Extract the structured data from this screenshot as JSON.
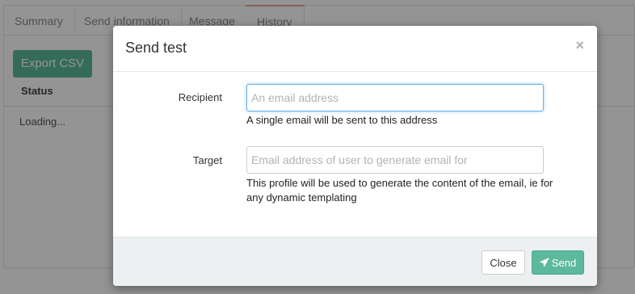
{
  "background": {
    "tabs": [
      "Summary",
      "Send information",
      "Message",
      "History"
    ],
    "active_tab": "History",
    "export_label": "Export CSV",
    "status_header": "Status",
    "loading_text": "Loading..."
  },
  "modal": {
    "title": "Send test",
    "close_symbol": "×",
    "recipient": {
      "label": "Recipient",
      "placeholder": "An email address",
      "value": "",
      "help": "A single email will be sent to this address"
    },
    "target": {
      "label": "Target",
      "placeholder": "Email address of user to generate email for",
      "value": "",
      "help": "This profile will be used to generate the content of the email, ie for any dynamic templating"
    },
    "footer": {
      "close_label": "Close",
      "send_label": "Send",
      "send_icon": "paper-plane-icon"
    }
  },
  "colors": {
    "primary": "#5cb99b",
    "footer_bg": "#ecf0f1",
    "focus": "#66afe9",
    "active_tab_accent": "#e5a59f"
  }
}
